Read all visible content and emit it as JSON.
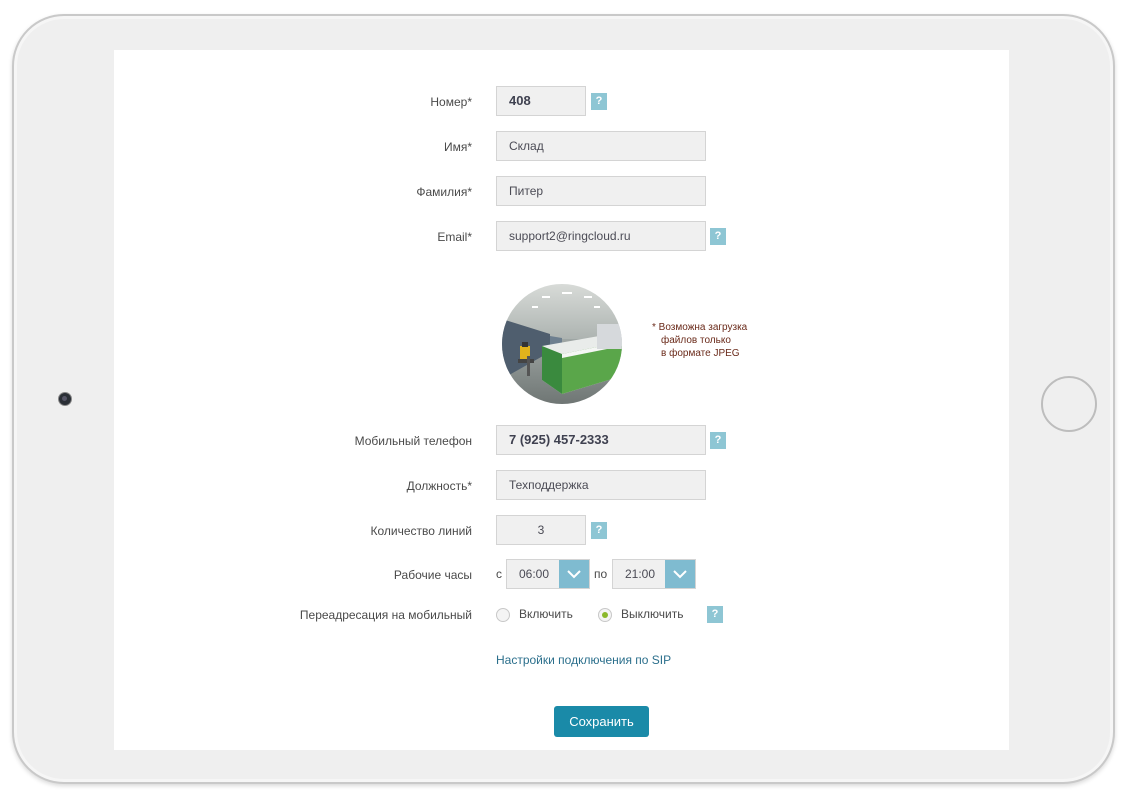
{
  "form": {
    "number": {
      "label": "Номер*",
      "value": "408"
    },
    "first_name": {
      "label": "Имя*",
      "value": "Склад"
    },
    "last_name": {
      "label": "Фамилия*",
      "value": "Питер"
    },
    "email": {
      "label": "Email*",
      "value": "support2@ringcloud.ru"
    },
    "photo_note": [
      "* Возможна загрузка",
      "файлов только",
      "в формате JPEG"
    ],
    "mobile": {
      "label": "Мобильный телефон",
      "value": "7 (925) 457-2333"
    },
    "position": {
      "label": "Должность*",
      "value": "Техподдержка"
    },
    "lines": {
      "label": "Количество линий",
      "value": "3"
    },
    "hours": {
      "label": "Рабочие часы",
      "from_prefix": "с",
      "from_value": "06:00",
      "to_prefix": "по",
      "to_value": "21:00"
    },
    "forwarding": {
      "label": "Переадресация на мобильный",
      "option_on": "Включить",
      "option_off": "Выключить",
      "selected": "Выключить"
    },
    "sip_link": "Настройки подключения по SIP",
    "save_label": "Сохранить",
    "help_glyph": "?"
  },
  "colors": {
    "accent": "#1a8aa8",
    "help": "#8ec6d4",
    "radio_selected": "#8ab82b"
  }
}
